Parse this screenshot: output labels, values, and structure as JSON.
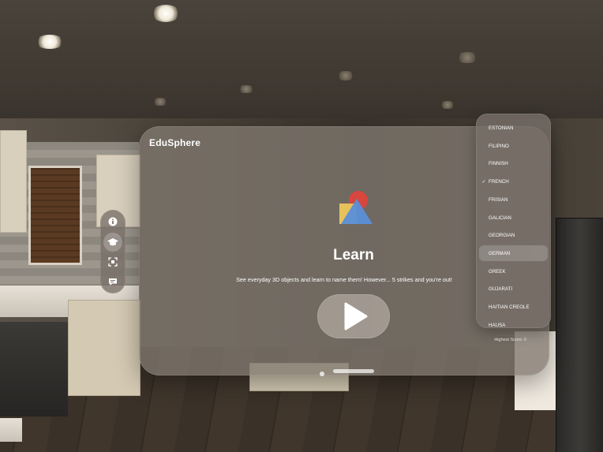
{
  "app": {
    "title": "EduSphere"
  },
  "main": {
    "heading": "Learn",
    "description": "See everyday 3D objects and learn to name them! However... 5 strikes and you're out!",
    "highest_score": "Highest Score: 0"
  },
  "ornament": {
    "items": [
      {
        "icon": "info-icon",
        "active": false
      },
      {
        "icon": "graduation-cap-icon",
        "active": true
      },
      {
        "icon": "scan-icon",
        "active": false
      },
      {
        "icon": "chat-bubble-icon",
        "active": false
      }
    ]
  },
  "languages": {
    "items": [
      {
        "label": "ESTONIAN"
      },
      {
        "label": "FILIPINO"
      },
      {
        "label": "FINNISH"
      },
      {
        "label": "FRENCH",
        "selected": true,
        "check": "✓"
      },
      {
        "label": "FRISIAN"
      },
      {
        "label": "GALICIAN"
      },
      {
        "label": "GEORGIAN"
      },
      {
        "label": "GERMAN",
        "hovered": true
      },
      {
        "label": "GREEK"
      },
      {
        "label": "GUJARATI"
      },
      {
        "label": "HAITIAN CREOLE"
      },
      {
        "label": "HAUSA"
      }
    ]
  },
  "colors": {
    "glass": "#807870",
    "shape_red": "#d9463d",
    "shape_yellow": "#e7c15a",
    "shape_blue": "#5a8fd8"
  }
}
